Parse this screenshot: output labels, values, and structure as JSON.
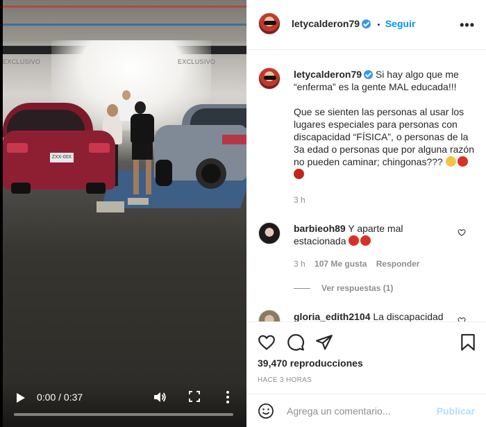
{
  "video": {
    "sign_left": "EXCLUSIVO",
    "sign_right": "EXCLUSIVO",
    "plate": "ZXX-00X",
    "time": "0:00 / 0:37",
    "progress_fraction": 0.0
  },
  "header": {
    "username": "letycalderon79",
    "separator": "•",
    "follow_label": "Seguir",
    "more_label": "•••"
  },
  "caption": {
    "username": "letycalderon79",
    "text_1": "Si hay algo que me “enferma” es la gente MAL educada!!!",
    "text_2": "Que se sienten las personas al usar los lugares especiales para personas con discapacidad “FÍSICA”, o personas de la 3a edad o personas que por alguna razón no pueden caminar; chingonas???",
    "emojis": [
      "tired-face-emoji",
      "angry-face-emoji",
      "cursing-face-emoji"
    ],
    "time": "3 h"
  },
  "comments": [
    {
      "username": "barbieoh89",
      "text": "Y aparte mal estacionada",
      "emojis": [
        "angry-face-emoji",
        "angry-face-emoji"
      ],
      "time": "3 h",
      "likes": "107 Me gusta",
      "reply_label": "Responder"
    },
    {
      "username": "gloria_edith2104",
      "text": "La discapacidad"
    }
  ],
  "view_replies": "Ver respuestas (1)",
  "stats": {
    "views": "39,470 reproducciones",
    "ago": "HACE 3 HORAS"
  },
  "add_comment": {
    "placeholder": "Agrega un comentario...",
    "publish_label": "Publicar"
  },
  "colors": {
    "accent": "#0095f6",
    "verified": "#3897f0",
    "publish_disabled": "#b2dffc",
    "muted": "#8e8e8e"
  }
}
